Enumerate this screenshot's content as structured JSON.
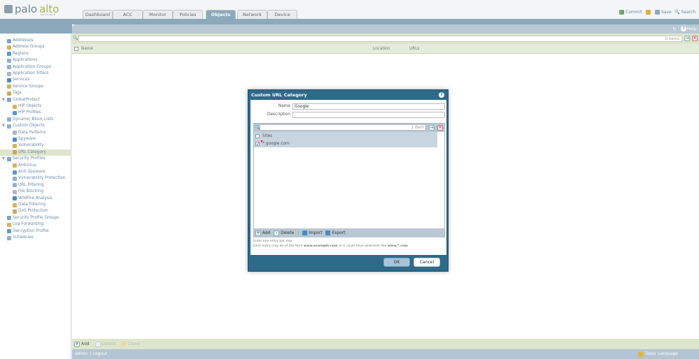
{
  "header": {
    "logo_text_1": "palo",
    "logo_text_2": "alto",
    "logo_sub": "NETWORKS",
    "tabs": [
      "Dashboard",
      "ACC",
      "Monitor",
      "Policies",
      "Objects",
      "Network",
      "Device"
    ],
    "active_tab": "Objects",
    "commit": "Commit",
    "save": "Save",
    "search": "Search"
  },
  "sidebar": {
    "items": [
      {
        "label": "Addresses",
        "level": 0
      },
      {
        "label": "Address Groups",
        "level": 0
      },
      {
        "label": "Regions",
        "level": 0
      },
      {
        "label": "Applications",
        "level": 0
      },
      {
        "label": "Application Groups",
        "level": 0
      },
      {
        "label": "Application Filters",
        "level": 0
      },
      {
        "label": "Services",
        "level": 0
      },
      {
        "label": "Service Groups",
        "level": 0
      },
      {
        "label": "Tags",
        "level": 0
      },
      {
        "label": "GlobalProtect",
        "level": 0,
        "expanded": true
      },
      {
        "label": "HIP Objects",
        "level": 1
      },
      {
        "label": "HIP Profiles",
        "level": 1
      },
      {
        "label": "Dynamic Block Lists",
        "level": 0
      },
      {
        "label": "Custom Objects",
        "level": 0,
        "expanded": true
      },
      {
        "label": "Data Patterns",
        "level": 1
      },
      {
        "label": "Spyware",
        "level": 1
      },
      {
        "label": "Vulnerability",
        "level": 1
      },
      {
        "label": "URL Category",
        "level": 1,
        "selected": true
      },
      {
        "label": "Security Profiles",
        "level": 0,
        "expanded": true
      },
      {
        "label": "Antivirus",
        "level": 1
      },
      {
        "label": "Anti-Spyware",
        "level": 1
      },
      {
        "label": "Vulnerability Protection",
        "level": 1
      },
      {
        "label": "URL Filtering",
        "level": 1
      },
      {
        "label": "File Blocking",
        "level": 1
      },
      {
        "label": "WildFire Analysis",
        "level": 1
      },
      {
        "label": "Data Filtering",
        "level": 1
      },
      {
        "label": "DoS Protection",
        "level": 1
      },
      {
        "label": "Security Profile Groups",
        "level": 0
      },
      {
        "label": "Log Forwarding",
        "level": 0
      },
      {
        "label": "Decryption Profile",
        "level": 0
      },
      {
        "label": "Schedules",
        "level": 0
      }
    ]
  },
  "main": {
    "help": "Help",
    "item_count": "0 items",
    "columns": [
      "Name",
      "Location",
      "URLs"
    ],
    "actions": {
      "add": "Add",
      "delete": "Delete",
      "clone": "Clone"
    }
  },
  "footer": {
    "user": "admin",
    "logout": "Logout",
    "tasks": "Tasks",
    "language": "Language"
  },
  "dialog": {
    "title": "Custom URL Category",
    "name_label": "Name",
    "name_value": "Google",
    "description_label": "Description",
    "description_value": "",
    "item_count": "1 item",
    "column": "Sites",
    "sites": [
      "*.google.com"
    ],
    "actions": {
      "add": "Add",
      "delete": "Delete",
      "import": "Import",
      "export": "Export"
    },
    "hint_line1": "Enter one entry per row.",
    "hint_line2_a": "Each entry may be of the form ",
    "hint_example": "www.example.com",
    "hint_line2_b": " or it could have wildcards like ",
    "hint_wild": "www.*.com",
    "ok": "OK",
    "cancel": "Cancel"
  }
}
